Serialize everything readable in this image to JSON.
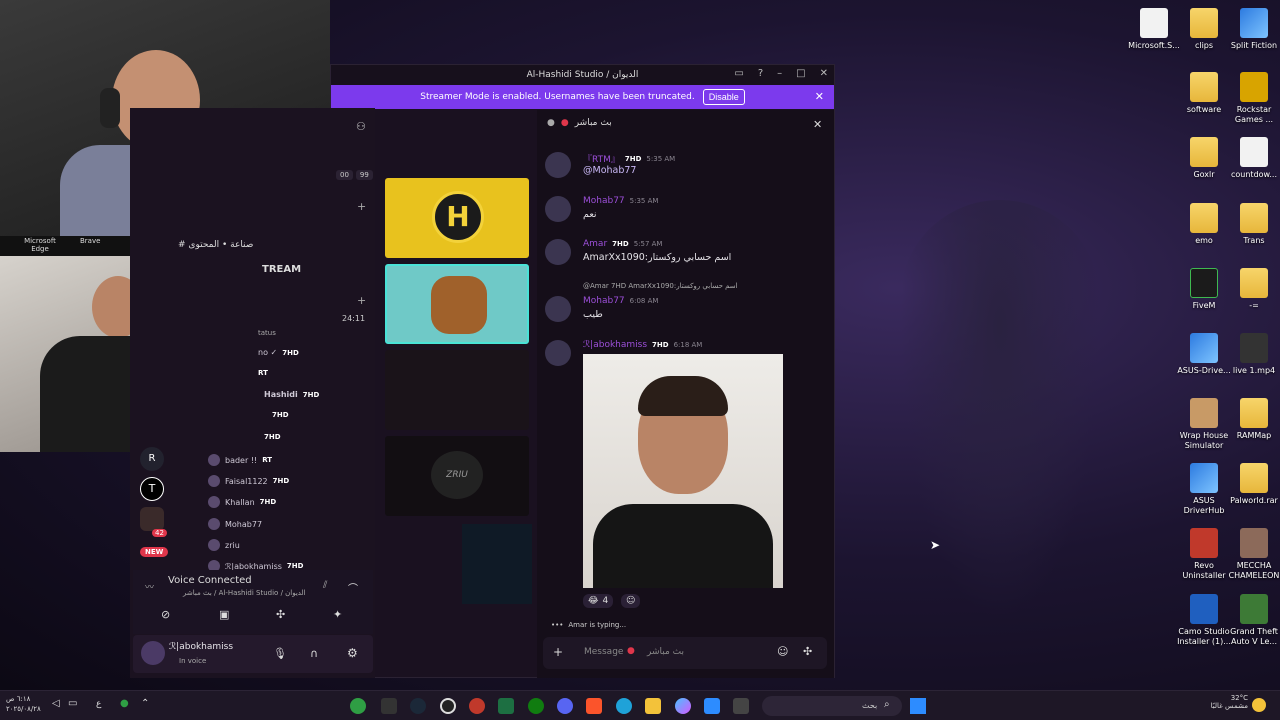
{
  "window": {
    "title": "Al-Hashidi Studio / الديوان",
    "banner_text": "Streamer Mode is enabled. Usernames have been truncated.",
    "banner_button": "Disable"
  },
  "overlay": {
    "browser_edge": "Microsoft Edge",
    "browser_brave": "Brave",
    "top_channel": "صناعة • المحتوى",
    "stream_label": "TREAM",
    "count_badge": "99",
    "count_badge_zero": "00",
    "status_text": "tatus",
    "timer": "24:11"
  },
  "members": [
    {
      "name": "no ✓",
      "tag": "7HD"
    },
    {
      "name": "",
      "tag": "RT"
    },
    {
      "name": "Hashidi",
      "tag": "7HD"
    },
    {
      "name": "",
      "tag": "7HD"
    },
    {
      "name": "",
      "tag": "7HD"
    },
    {
      "name": "bader !!",
      "tag": "RT"
    },
    {
      "name": "Faisal1122",
      "tag": "7HD"
    },
    {
      "name": "Khallan",
      "tag": "7HD"
    },
    {
      "name": "Mohab77",
      "tag": ""
    },
    {
      "name": "zriu",
      "tag": ""
    },
    {
      "name": "ℛ|abokhamiss",
      "tag": "7HD"
    }
  ],
  "sidebar": {
    "badge_42": "42",
    "new_badge": "NEW"
  },
  "voice": {
    "status": "Voice Connected",
    "location": "بث مباشر / Al-Hashidi Studio / الديوان"
  },
  "user_panel": {
    "name": "ℛ|abokhamiss",
    "status": "In voice"
  },
  "chat": {
    "header": "بث مباشر",
    "messages": [
      {
        "name": "『RTM』",
        "tag": "7HD",
        "time": "5:35 AM",
        "body": "@Mohab77"
      },
      {
        "name": "Mohab77",
        "tag": "",
        "time": "5:35 AM",
        "body": "نعم"
      },
      {
        "name": "Amar",
        "tag": "7HD",
        "time": "5:57 AM",
        "body": "AmarXx1090:اسم حسابي روكستار"
      },
      {
        "reply": "@Amar  7HD  AmarXx1090:اسم حسابي روكستار",
        "name": "Mohab77",
        "tag": "",
        "time": "6:08 AM",
        "body": "طيب"
      },
      {
        "name": "ℛ|abokhamiss",
        "tag": "7HD",
        "time": "6:18 AM",
        "body": ""
      }
    ],
    "reaction_count": "4",
    "typing": "Amar is typing...",
    "input_placeholder": "Message",
    "input_channel": "بث مباشر"
  },
  "desktop_icons": [
    {
      "label": "Microsoft.S...",
      "icon": "file-icon"
    },
    {
      "label": "clips",
      "icon": "folder-icon"
    },
    {
      "label": "Split Fiction",
      "icon": "app-icon"
    },
    {
      "label": "software",
      "icon": "folder-icon"
    },
    {
      "label": "Rockstar Games ...",
      "icon": "app-icon"
    },
    {
      "label": "Goxlr",
      "icon": "folder-icon"
    },
    {
      "label": "countdow...",
      "icon": "file-icon"
    },
    {
      "label": "emo",
      "icon": "folder-icon"
    },
    {
      "label": "Trans",
      "icon": "folder-icon"
    },
    {
      "label": "FiveM",
      "icon": "app-icon"
    },
    {
      "label": "-=",
      "icon": "folder-icon"
    },
    {
      "label": "ASUS-Drive...",
      "icon": "app-icon"
    },
    {
      "label": "live 1.mp4",
      "icon": "file-icon"
    },
    {
      "label": "Wrap House Simulator",
      "icon": "app-icon"
    },
    {
      "label": "RAMMap",
      "icon": "folder-icon"
    },
    {
      "label": "ASUS DriverHub",
      "icon": "app-icon"
    },
    {
      "label": "Palworld.rar",
      "icon": "folder-icon"
    },
    {
      "label": "Revo Uninstaller",
      "icon": "app-icon"
    },
    {
      "label": "MECCHA CHAMELEON",
      "icon": "app-icon"
    },
    {
      "label": "Camo Studio Installer (1)...",
      "icon": "app-icon"
    },
    {
      "label": "Grand Theft Auto V Le...",
      "icon": "app-icon"
    }
  ],
  "taskbar": {
    "search_placeholder": "بحث",
    "time": "٦:١٨ ص",
    "date": "٢٠٢٥/٠٨/٢٨",
    "lang": "ع",
    "weather_temp": "32°C",
    "weather_desc": "مشمس غالبًا"
  },
  "colors": {
    "accent": "#7c3aed",
    "username": "#9b4fd8",
    "tag_color": "#ffffff"
  }
}
